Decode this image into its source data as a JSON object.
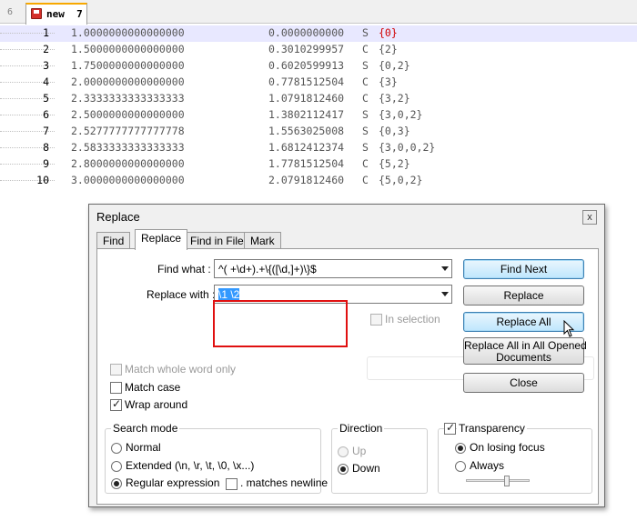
{
  "editor": {
    "tab_number": "6",
    "tab_title": "new  7",
    "lines": [
      {
        "no": "1",
        "a": "1.0000000000000000",
        "b": "0.0000000000",
        "c": "S",
        "d": "{0}",
        "current": true
      },
      {
        "no": "2",
        "a": "1.5000000000000000",
        "b": "0.3010299957",
        "c": "C",
        "d": "{2}"
      },
      {
        "no": "3",
        "a": "1.7500000000000000",
        "b": "0.6020599913",
        "c": "S",
        "d": "{0,2}"
      },
      {
        "no": "4",
        "a": "2.0000000000000000",
        "b": "0.7781512504",
        "c": "C",
        "d": "{3}"
      },
      {
        "no": "5",
        "a": "2.3333333333333333",
        "b": "1.0791812460",
        "c": "C",
        "d": "{3,2}"
      },
      {
        "no": "6",
        "a": "2.5000000000000000",
        "b": "1.3802112417",
        "c": "S",
        "d": "{3,0,2}"
      },
      {
        "no": "7",
        "a": "2.5277777777777778",
        "b": "1.5563025008",
        "c": "S",
        "d": "{0,3}"
      },
      {
        "no": "8",
        "a": "2.5833333333333333",
        "b": "1.6812412374",
        "c": "S",
        "d": "{3,0,0,2}"
      },
      {
        "no": "9",
        "a": "2.8000000000000000",
        "b": "1.7781512504",
        "c": "C",
        "d": "{5,2}"
      },
      {
        "no": "10",
        "a": "3.0000000000000000",
        "b": "2.0791812460",
        "c": "C",
        "d": "{5,0,2}"
      }
    ]
  },
  "dialog": {
    "title": "Replace",
    "close_label": "x",
    "tabs": [
      "Find",
      "Replace",
      "Find in Files",
      "Mark"
    ],
    "find_what_label": "Find what :",
    "find_what_value": "^( +\\d+).+\\{([\\d,]+)\\}$",
    "replace_with_label": "Replace with :",
    "replace_with_value": "\\1 \\2",
    "in_selection_label": "In selection",
    "buttons": {
      "find_next": "Find Next",
      "replace": "Replace",
      "replace_all": "Replace All",
      "replace_all_opened_1": "Replace All in All Opened",
      "replace_all_opened_2": "Documents",
      "close": "Close"
    },
    "options": {
      "match_whole_word": "Match whole word only",
      "match_case": "Match case",
      "wrap_around": "Wrap around"
    },
    "search_mode": {
      "title": "Search mode",
      "normal": "Normal",
      "extended": "Extended (\\n, \\r, \\t, \\0, \\x...)",
      "regex": "Regular expression",
      "matches_newline": ". matches newline"
    },
    "direction": {
      "title": "Direction",
      "up": "Up",
      "down": "Down"
    },
    "transparency": {
      "title": "Transparency",
      "on_losing_focus": "On losing focus",
      "always": "Always"
    },
    "colors": {
      "highlight_box": "#e01010",
      "selection": "#3399ff",
      "current_line": "#e8e8ff"
    }
  }
}
